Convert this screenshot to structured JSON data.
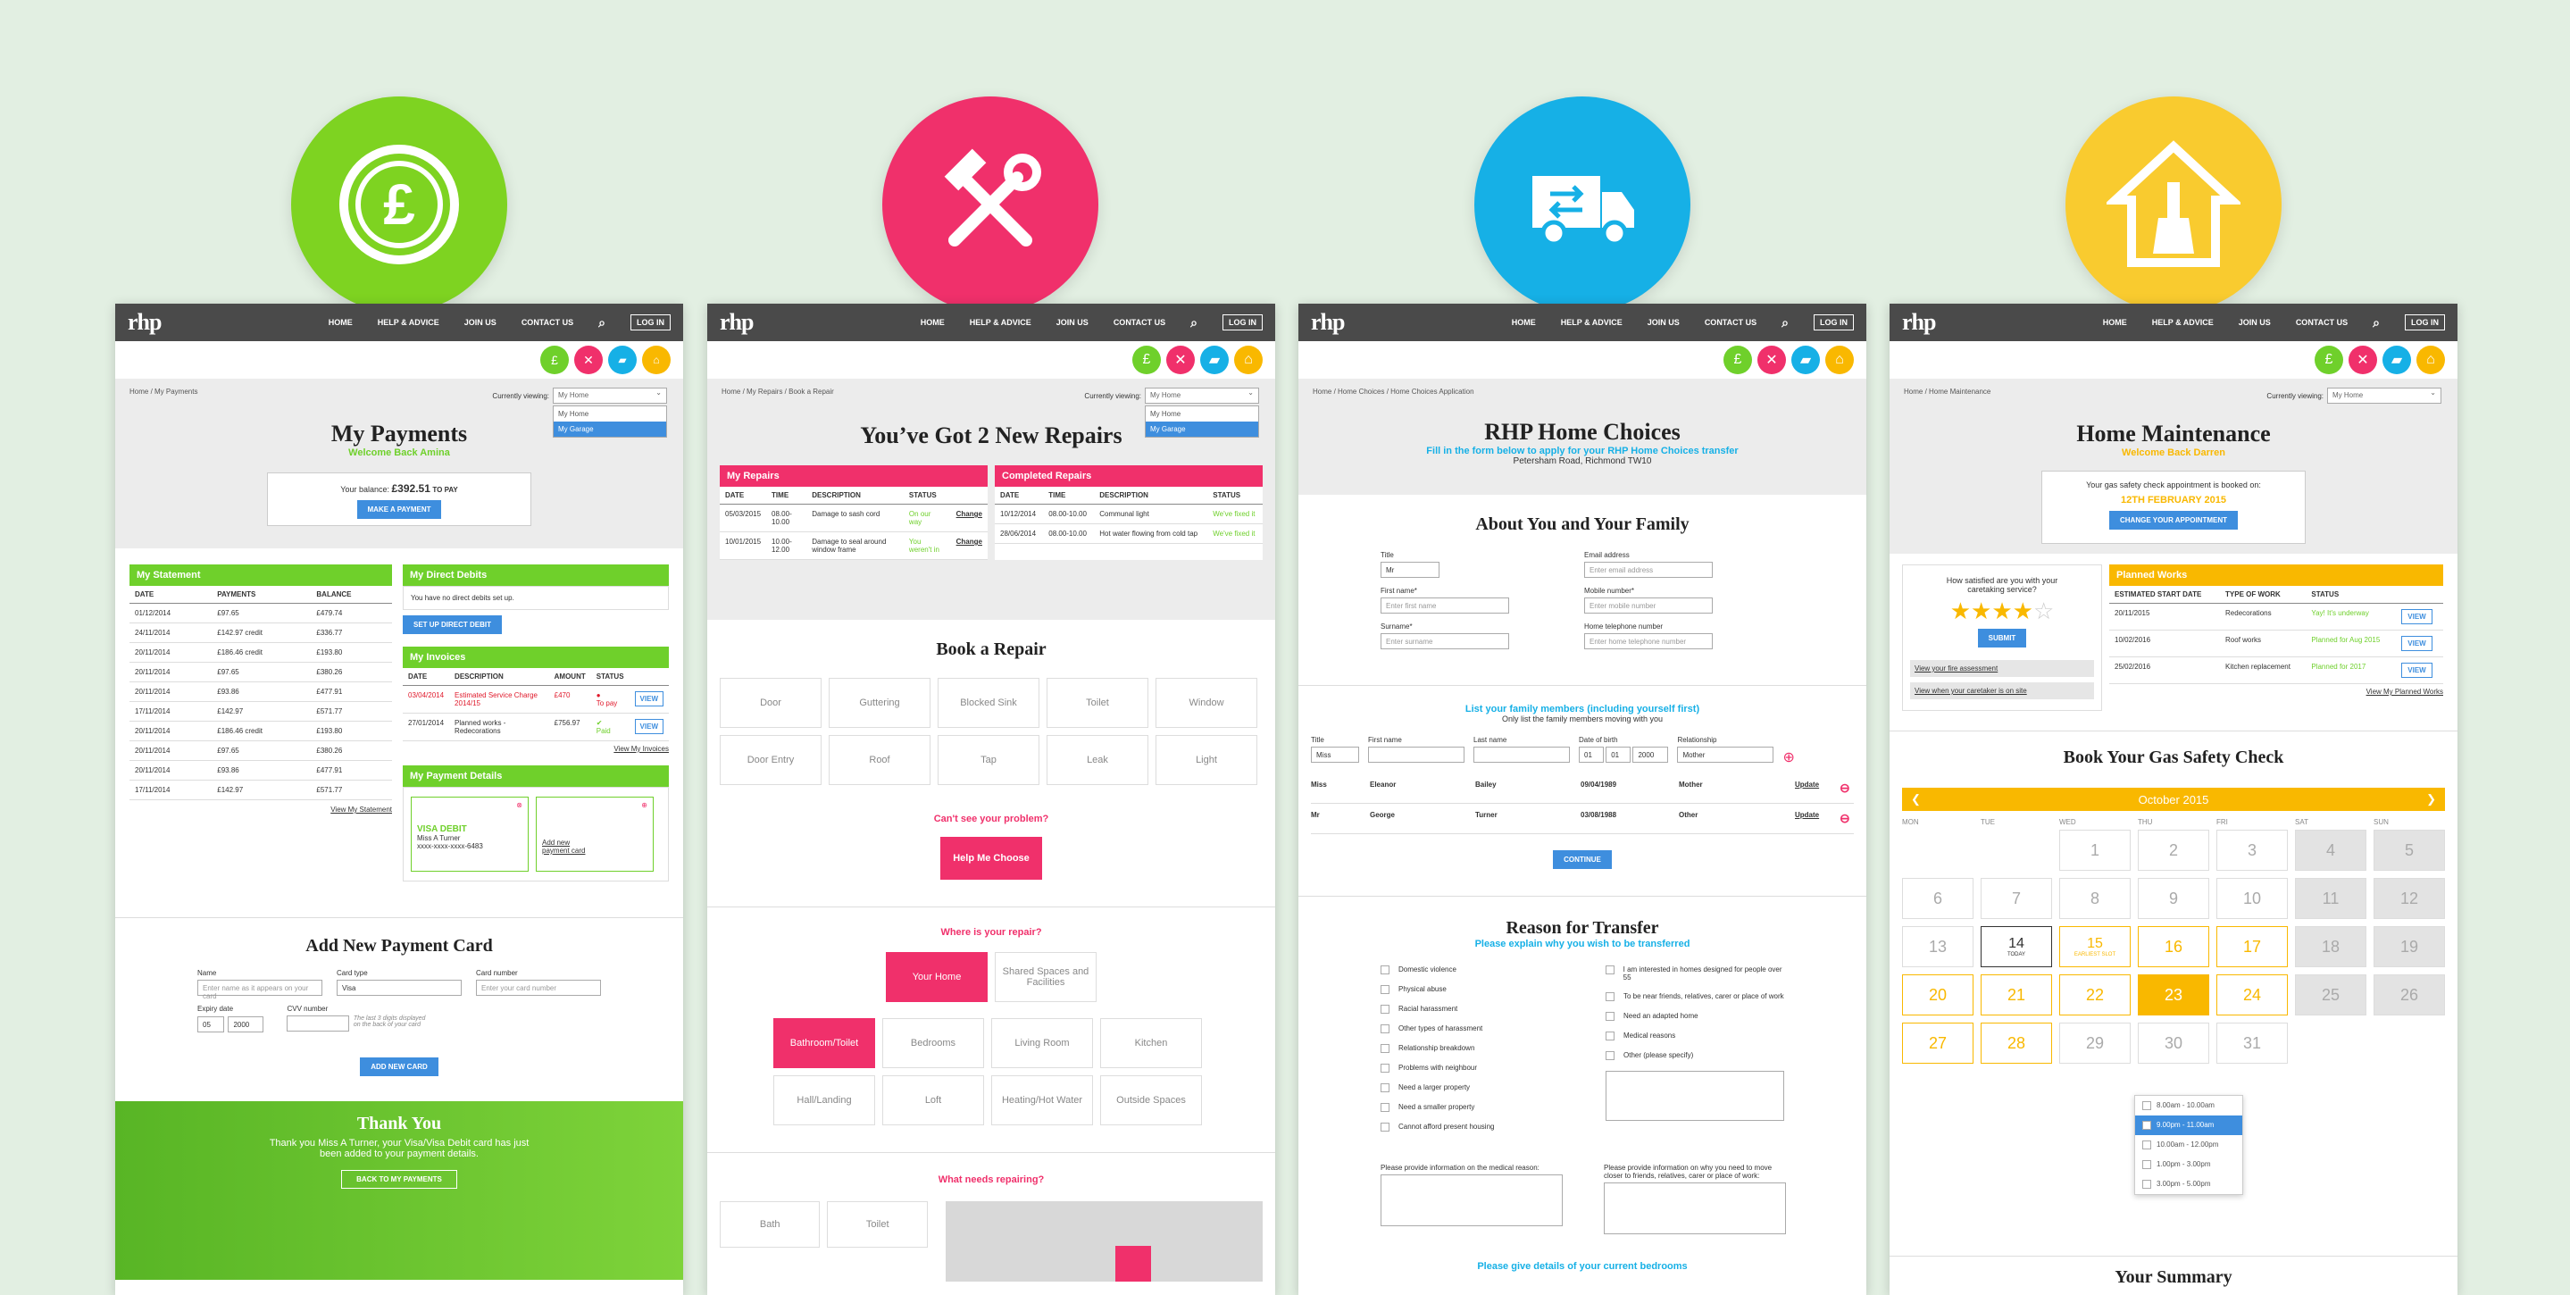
{
  "hero_icons": [
    {
      "name": "pound-icon",
      "color": "#7ed321"
    },
    {
      "name": "tools-icon",
      "color": "#f0306b"
    },
    {
      "name": "removal-truck-icon",
      "color": "#16b0e6"
    },
    {
      "name": "home-paintbrush-icon",
      "color": "#f9cb2f"
    }
  ],
  "nav": {
    "logo": "rhp",
    "home": "HOME",
    "help": "HELP & ADVICE",
    "join": "JOIN US",
    "contact": "CONTACT US",
    "login": "LOG IN"
  },
  "viewing_label": "Currently viewing:",
  "viewing_options": [
    "My Home",
    "My Garage"
  ],
  "payments": {
    "crumb": "Home / My Payments",
    "title": "My Payments",
    "welcome": "Welcome Back Amina",
    "balance_label": "Your balance:",
    "balance": "£392.51",
    "balance_suffix": "TO PAY",
    "make_payment": "MAKE A PAYMENT",
    "statement_title": "My Statement",
    "statement_cols": [
      "DATE",
      "PAYMENTS",
      "BALANCE"
    ],
    "statement_rows": [
      [
        "01/12/2014",
        "£97.65",
        "£479.74"
      ],
      [
        "24/11/2014",
        "£142.97 credit",
        "£336.77"
      ],
      [
        "20/11/2014",
        "£186.46 credit",
        "£193.80"
      ],
      [
        "20/11/2014",
        "£97.65",
        "£380.26"
      ],
      [
        "20/11/2014",
        "£93.86",
        "£477.91"
      ],
      [
        "17/11/2014",
        "£142.97",
        "£571.77"
      ],
      [
        "20/11/2014",
        "£186.46 credit",
        "£193.80"
      ],
      [
        "20/11/2014",
        "£97.65",
        "£380.26"
      ],
      [
        "20/11/2014",
        "£93.86",
        "£477.91"
      ],
      [
        "17/11/2014",
        "£142.97",
        "£571.77"
      ]
    ],
    "view_statement": "View My Statement",
    "dd_title": "My Direct Debits",
    "dd_text": "You have no direct debits set up.",
    "dd_button": "SET UP DIRECT DEBIT",
    "inv_title": "My Invoices",
    "inv_cols": [
      "DATE",
      "DESCRIPTION",
      "AMOUNT",
      "STATUS"
    ],
    "inv_rows": [
      [
        "03/04/2014",
        "Estimated Service Charge 2014/15",
        "£470",
        "To pay"
      ],
      [
        "27/01/2014",
        "Planned works - Redecorations",
        "£756.97",
        "Paid"
      ]
    ],
    "view": "VIEW",
    "view_invoices": "View My Invoices",
    "pd_title": "My Payment Details",
    "visa_label": "VISA DEBIT",
    "visa_name": "Miss A Turner",
    "visa_num": "xxxx-xxxx-xxxx-6483",
    "add_card_text": "Add new payment card",
    "new_card_title": "Add New Payment Card",
    "name_label": "Name",
    "name_ph": "Enter name as it appears on your card",
    "cardtype_label": "Card type",
    "cardtype_val": "Visa",
    "cardnum_label": "Card number",
    "cardnum_ph": "Enter your card number",
    "expiry_label": "Expiry date",
    "expiry_m": "05",
    "expiry_y": "2000",
    "cvv_label": "CVV number",
    "cvv_help": "The last 3 digits displayed on the back of your card",
    "add_card_btn": "ADD NEW CARD",
    "thank_title": "Thank You",
    "thank_text": "Thank you Miss A Turner, your Visa/Visa Debit card has just been added to your payment details.",
    "back_btn": "BACK TO MY PAYMENTS"
  },
  "repairs": {
    "crumb": "Home / My Repairs / Book a Repair",
    "title": "You’ve Got 2 New Repairs",
    "my_title": "My Repairs",
    "completed_title": "Completed Repairs",
    "cols": [
      "DATE",
      "TIME",
      "DESCRIPTION",
      "STATUS"
    ],
    "my_rows": [
      [
        "05/03/2015",
        "08.00-10.00",
        "Damage to sash cord",
        "On our way",
        "Change"
      ],
      [
        "10/01/2015",
        "10.00-12.00",
        "Damage to seal around window frame",
        "You weren't in",
        "Change"
      ]
    ],
    "done_rows": [
      [
        "10/12/2014",
        "08.00-10.00",
        "Communal light",
        "We've fixed it"
      ],
      [
        "28/06/2014",
        "08.00-10.00",
        "Hot water flowing from cold tap",
        "We've fixed it"
      ]
    ],
    "book_title": "Book a Repair",
    "tiles": [
      "Door",
      "Guttering",
      "Blocked Sink",
      "Toilet",
      "Window",
      "Door Entry",
      "Roof",
      "Tap",
      "Leak",
      "Light"
    ],
    "cant_see": "Can't see your problem?",
    "help_choose": "Help Me Choose",
    "where": "Where is your repair?",
    "your_home": "Your Home",
    "shared": "Shared Spaces and Facilities",
    "rooms": [
      "Bathroom/Toilet",
      "Bedrooms",
      "Living Room",
      "Kitchen",
      "Hall/Landing",
      "Loft",
      "Heating/Hot Water",
      "Outside Spaces"
    ],
    "needs": "What needs repairing?",
    "items": [
      "Bath",
      "Toilet"
    ]
  },
  "choices": {
    "crumb": "Home / Home Choices / Home Choices Application",
    "title": "RHP Home Choices",
    "sub": "Fill in the form below to apply for your RHP Home Choices transfer",
    "address": "Petersham Road, Richmond TW10",
    "about": "About You and Your Family",
    "title_label": "Title",
    "title_val": "Mr",
    "first_label": "First name*",
    "first_ph": "Enter first name",
    "surname_label": "Surname*",
    "surname_ph": "Enter surname",
    "email_label": "Email address",
    "email_ph": "Enter email address",
    "mobile_label": "Mobile number*",
    "mobile_ph": "Enter mobile number",
    "hometel_label": "Home telephone number",
    "hometel_ph": "Enter home telephone number",
    "family_title": "List your family members (including yourself first)",
    "family_sub": "Only list the family members moving with you",
    "fam_cols": [
      "Title",
      "First name",
      "Last name",
      "Date of birth",
      "Relationship"
    ],
    "fam_row_title": "Miss",
    "fam_dob": [
      "01",
      "01",
      "2000"
    ],
    "fam_rel": "Mother",
    "fam_rows": [
      [
        "Miss",
        "Eleanor",
        "Bailey",
        "09/04/1989",
        "Mother",
        "Update"
      ],
      [
        "Mr",
        "George",
        "Turner",
        "03/08/1988",
        "Other",
        "Update"
      ]
    ],
    "continue": "CONTINUE",
    "reason_title": "Reason for Transfer",
    "reason_sub": "Please explain why you wish to be transferred",
    "reasons_left": [
      "Domestic violence",
      "Physical abuse",
      "Racial harassment",
      "Other types of harassment",
      "Relationship breakdown",
      "Problems with neighbour",
      "Need a larger property",
      "Need a smaller property",
      "Cannot afford present housing"
    ],
    "reasons_right": [
      "I am interested in homes designed for people over 55",
      "To be near friends, relatives, carer or place of work",
      "Need an adapted home",
      "Medical reasons",
      "Other (please specify)"
    ],
    "medical_label": "Please provide information on the medical reason:",
    "move_label": "Please provide information on why you need to move closer to friends, relatives, carer or place of work:",
    "bedrooms": "Please give details of your current bedrooms"
  },
  "maint": {
    "crumb": "Home / Home Maintenance",
    "title": "Home Maintenance",
    "welcome": "Welcome Back Darren",
    "gas_text": "Your gas safety check appointment is booked on:",
    "gas_date": "12TH FEBRUARY 2015",
    "change_btn": "CHANGE YOUR APPOINTMENT",
    "satisfied": "How satisfied are you with your caretaking service?",
    "stars": 4,
    "submit": "SUBMIT",
    "fire": "View your fire assessment",
    "caretaker": "View when your caretaker is on site",
    "planned_title": "Planned Works",
    "planned_cols": [
      "ESTIMATED START DATE",
      "TYPE OF WORK",
      "STATUS"
    ],
    "planned_rows": [
      [
        "20/11/2015",
        "Redecorations",
        "Yay! It's underway"
      ],
      [
        "10/02/2016",
        "Roof works",
        "Planned for Aug 2015"
      ],
      [
        "25/02/2016",
        "Kitchen replacement",
        "Planned for 2017"
      ]
    ],
    "view": "VIEW",
    "view_planned": "View My Planned Works",
    "book_title": "Book Your Gas Safety Check",
    "month": "October 2015",
    "days": [
      "MON",
      "TUE",
      "WED",
      "THU",
      "FRI",
      "SAT",
      "SUN"
    ],
    "cal": [
      "",
      "",
      "1",
      "2",
      "3",
      "4",
      "5",
      "6",
      "7",
      "8",
      "9",
      "10",
      "11",
      "12",
      "13",
      "14",
      "15",
      "16",
      "17",
      "18",
      "19",
      "20",
      "21",
      "22",
      "23",
      "24",
      "25",
      "26",
      "27",
      "28",
      "29",
      "30",
      "31",
      "",
      ""
    ],
    "today": "TODAY",
    "earliest": "EARLIEST SLOT",
    "slots": [
      "8.00am - 10.00am",
      "9.00pm - 11.00am",
      "10.00am - 12.00pm",
      "1.00pm - 3.00pm",
      "3.00pm - 5.00pm"
    ],
    "summary": "Your Summary"
  },
  "colors": {
    "green": "#6fd02b",
    "pink": "#f0306b",
    "cyan": "#16b0e6",
    "yellow": "#f9b800",
    "blue": "#3e8ede"
  }
}
